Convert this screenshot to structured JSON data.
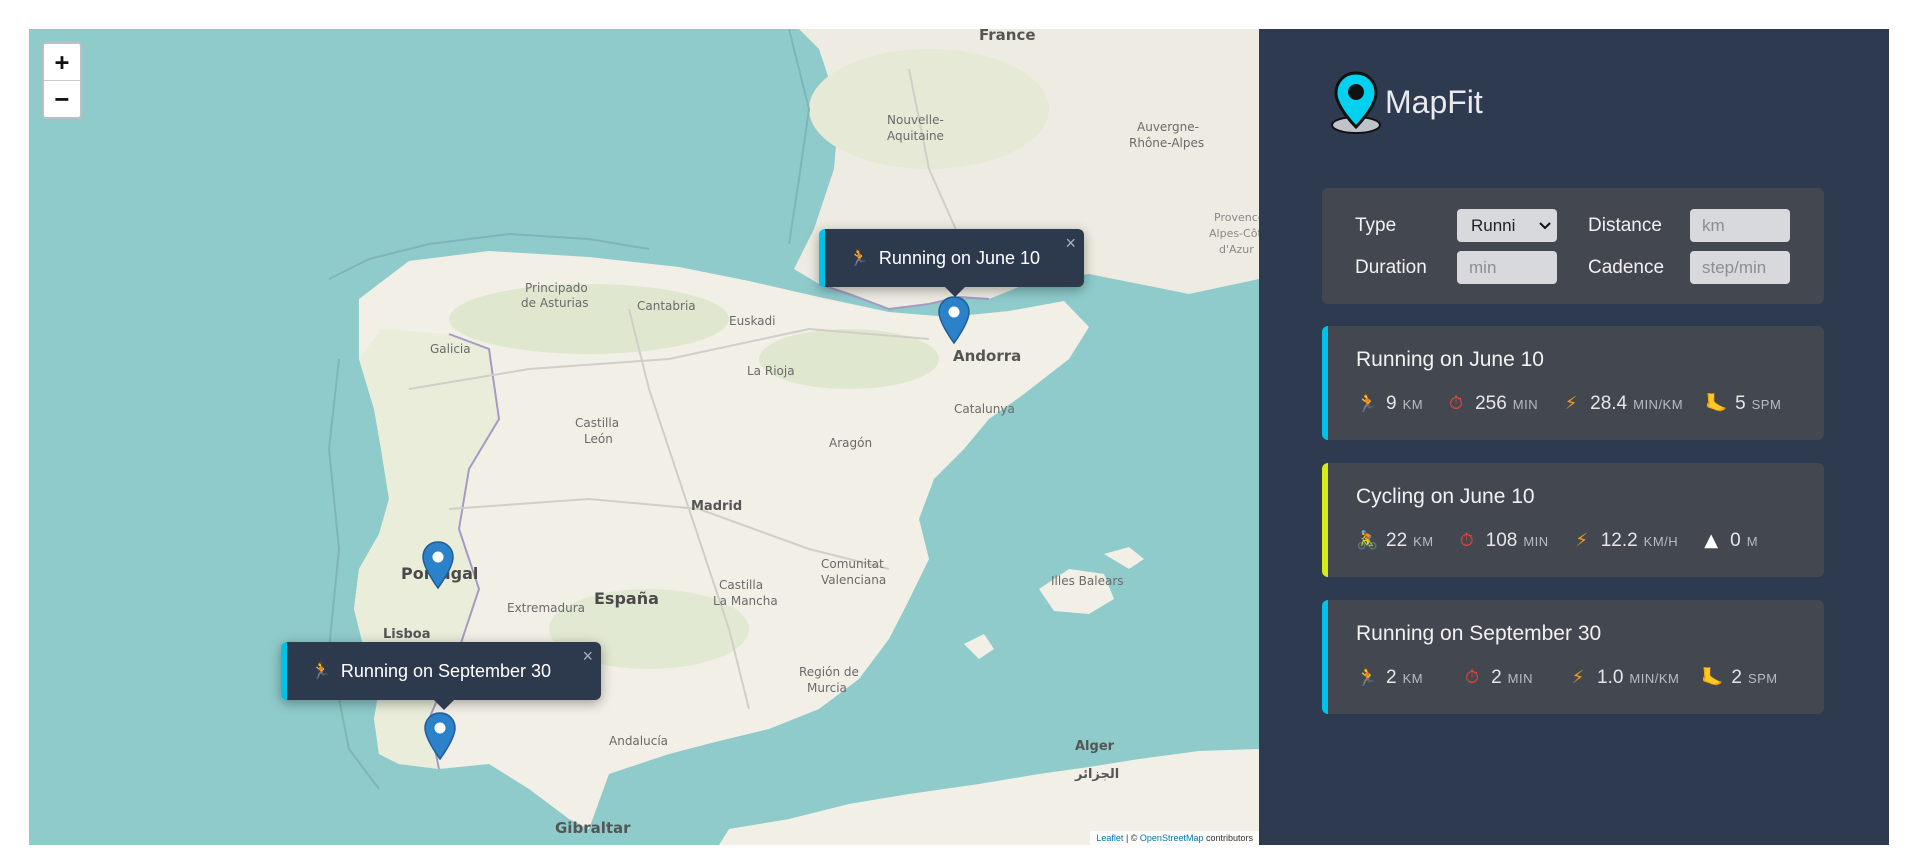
{
  "app": {
    "name": "MapFit"
  },
  "map": {
    "zoom_in": "+",
    "zoom_out": "−",
    "labels": {
      "france": "France",
      "nouvelle_aquitaine_1": "Nouvelle-",
      "nouvelle_aquitaine_2": "Aquitaine",
      "auvergne_1": "Auvergne-",
      "auvergne_2": "Rhône-Alpes",
      "provence_1": "Provence-",
      "provence_2": "Alpes-Côte",
      "provence_3": "d'Azur",
      "asturias_1": "Principado",
      "asturias_2": "de Asturias",
      "cantabria": "Cantabria",
      "euskadi": "Euskadi",
      "galicia": "Galicia",
      "rioja": "La Rioja",
      "castilla_leon_1": "Castilla",
      "castilla_leon_2": "León",
      "aragon": "Aragón",
      "catalunya": "Catalunya",
      "andorra": "Andorra",
      "madrid": "Madrid",
      "portugal": "Portugal",
      "espana": "España",
      "extremadura": "Extremadura",
      "lisboa": "Lisboa",
      "castilla_mancha_1": "Castilla",
      "castilla_mancha_2": "La Mancha",
      "comunitat_1": "Comunitat",
      "comunitat_2": "Valenciana",
      "illes_balears": "Illes Balears",
      "murcia_1": "Región de",
      "murcia_2": "Murcia",
      "andalucia": "Andalucía",
      "alger": "Alger",
      "alger_ar": "الجزائر",
      "gibraltar": "Gibraltar"
    },
    "popups": [
      {
        "text": "Running on June 10",
        "icon": "runner-icon",
        "close": "×"
      },
      {
        "text": "Running on September 30",
        "icon": "runner-icon",
        "close": "×"
      }
    ],
    "attribution": {
      "leaflet": "Leaflet",
      "sep": " | © ",
      "osm": "OpenStreetMap",
      "tail": " contributors"
    }
  },
  "form": {
    "type_label": "Type",
    "type_value": "Runni",
    "distance_label": "Distance",
    "distance_placeholder": "km",
    "duration_label": "Duration",
    "duration_placeholder": "min",
    "cadence_label": "Cadence",
    "cadence_placeholder": "step/min"
  },
  "workouts": [
    {
      "title": "Running on June 10",
      "type": "running",
      "distance": "9",
      "distance_unit": "KM",
      "duration": "256",
      "duration_unit": "MIN",
      "pace": "28.4",
      "pace_unit": "MIN/KM",
      "extra": "5",
      "extra_unit": "SPM"
    },
    {
      "title": "Cycling on June 10",
      "type": "cycling",
      "distance": "22",
      "distance_unit": "KM",
      "duration": "108",
      "duration_unit": "MIN",
      "pace": "12.2",
      "pace_unit": "KM/H",
      "extra": "0",
      "extra_unit": "M"
    },
    {
      "title": "Running on September 30",
      "type": "running",
      "distance": "2",
      "distance_unit": "KM",
      "duration": "2",
      "duration_unit": "MIN",
      "pace": "1.0",
      "pace_unit": "MIN/KM",
      "extra": "2",
      "extra_unit": "SPM"
    }
  ],
  "colors": {
    "running_accent": "#00c2e8",
    "cycling_accent": "#d8ea1a",
    "sidebar_bg": "#2d3a4f",
    "card_bg": "#434850",
    "sea": "#8fcbcb",
    "land": "#f2efe6"
  }
}
